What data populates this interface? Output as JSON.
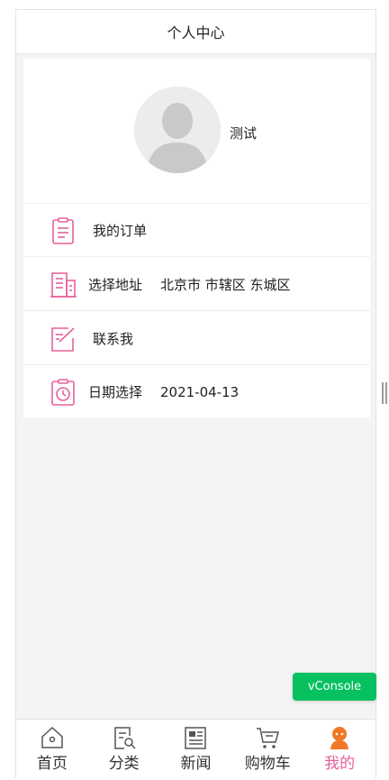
{
  "header": {
    "title": "个人中心"
  },
  "profile": {
    "username": "测试"
  },
  "menu": [
    {
      "label": "我的订单",
      "value": "",
      "icon": "order-list-icon"
    },
    {
      "label": "选择地址",
      "value": "北京市 市辖区 东城区",
      "icon": "address-icon"
    },
    {
      "label": "联系我",
      "value": "",
      "icon": "contact-edit-icon"
    },
    {
      "label": "日期选择",
      "value": "2021-04-13",
      "icon": "calendar-clock-icon"
    }
  ],
  "vconsole": {
    "label": "vConsole"
  },
  "tabbar": {
    "items": [
      {
        "label": "首页",
        "icon": "home-icon"
      },
      {
        "label": "分类",
        "icon": "category-search-icon"
      },
      {
        "label": "新闻",
        "icon": "news-icon"
      },
      {
        "label": "购物车",
        "icon": "cart-icon"
      },
      {
        "label": "我的",
        "icon": "user-icon"
      }
    ],
    "active_color": "#e8609a",
    "active_index": 4
  },
  "colors": {
    "accent": "#e8609a",
    "vconsole": "#07c160",
    "background": "#f4f4f4"
  }
}
